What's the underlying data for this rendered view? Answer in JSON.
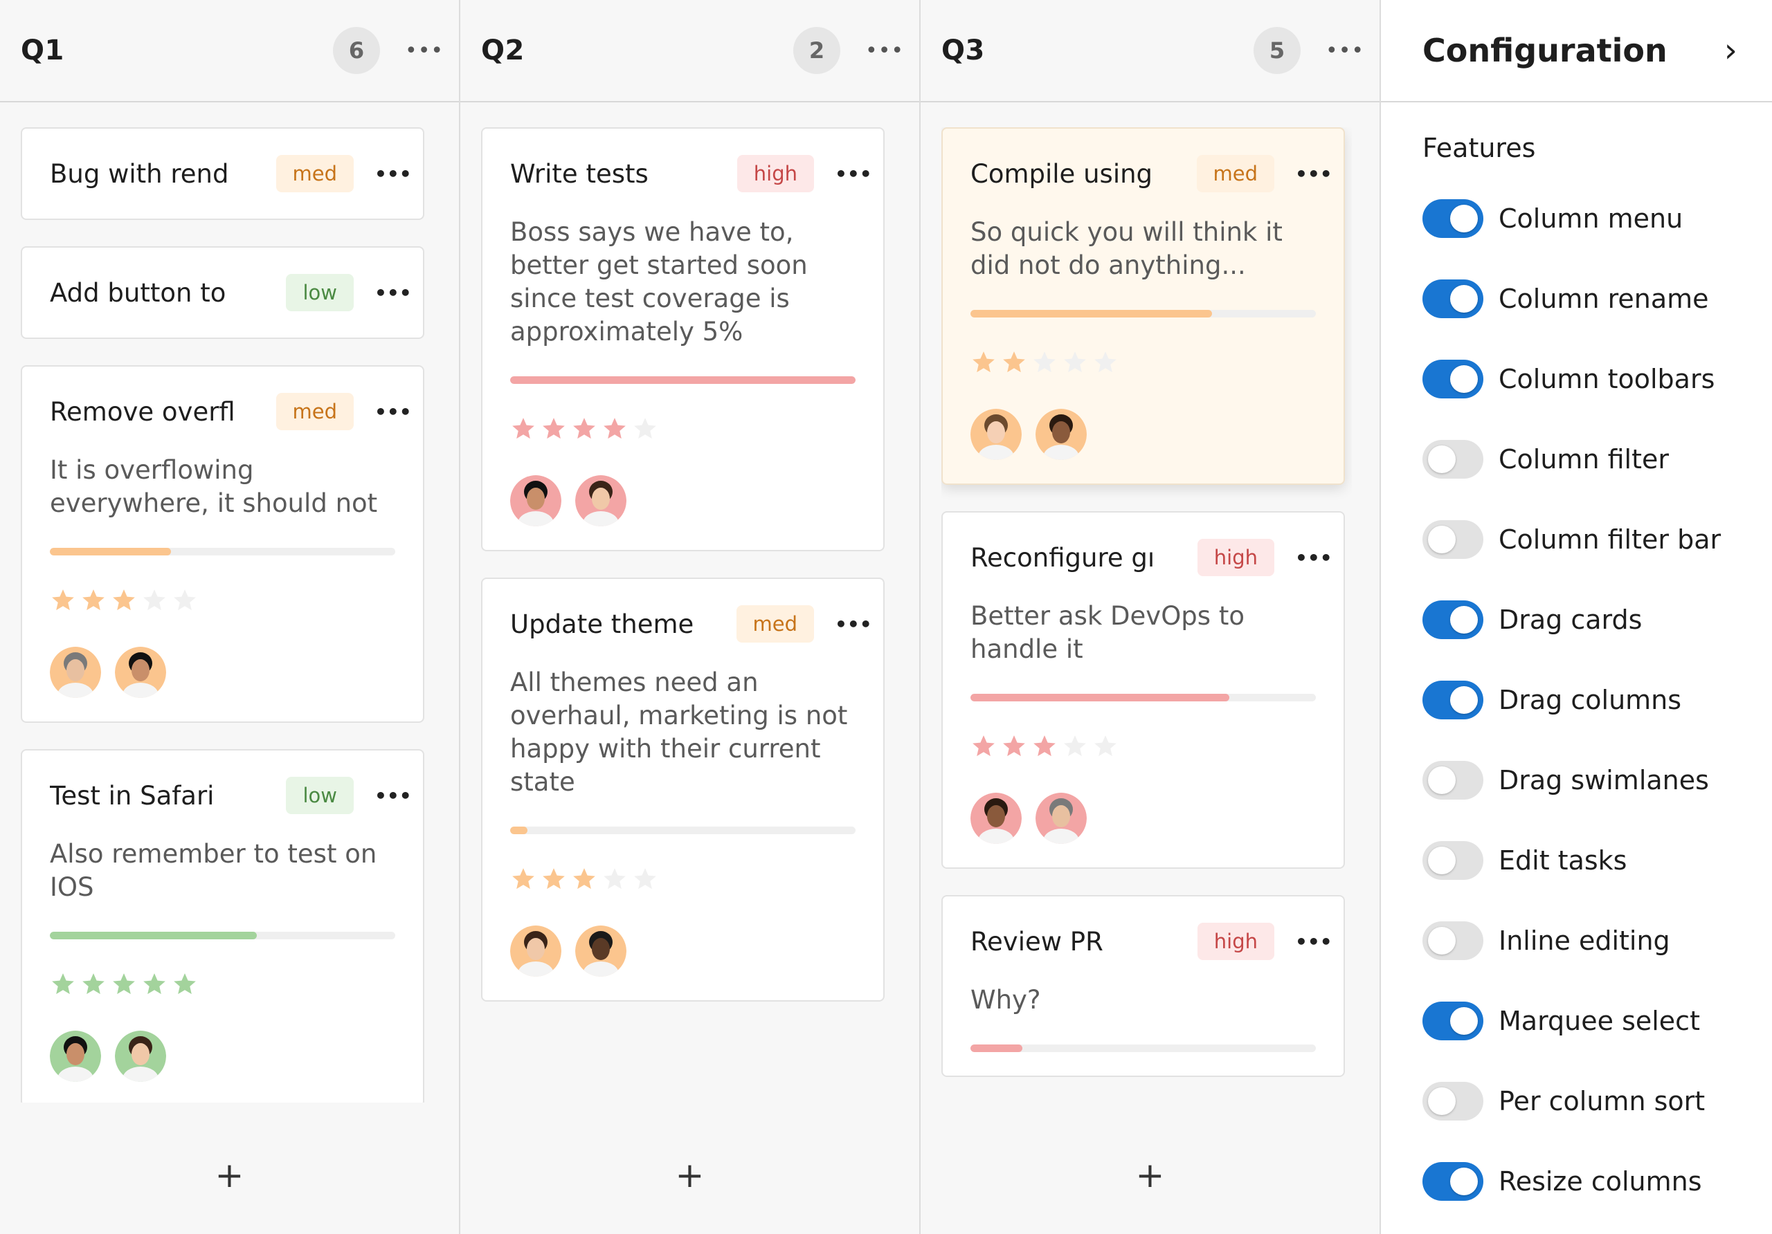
{
  "columns": [
    {
      "title": "Q1",
      "count": "6",
      "add_label": "+",
      "cards": [
        {
          "title": "Bug with rend",
          "priority": "med",
          "desc": "",
          "progress": 0,
          "stars": 0,
          "avatars": []
        },
        {
          "title": "Add button to",
          "priority": "low",
          "desc": "",
          "progress": 0,
          "stars": 0,
          "avatars": []
        },
        {
          "title": "Remove overfl",
          "priority": "med",
          "desc": "It is overflowing everywhere, it should not",
          "progress": 0.35,
          "stars": 3,
          "avatars": [
            "woman-curly",
            "man-beard"
          ]
        },
        {
          "title": "Test in Safari",
          "priority": "low",
          "desc": "Also remember to test on IOS",
          "progress": 0.6,
          "stars": 5,
          "avatars": [
            "man-beard-2",
            "woman-glasses"
          ]
        }
      ]
    },
    {
      "title": "Q2",
      "count": "2",
      "add_label": "+",
      "cards": [
        {
          "title": "Write tests",
          "priority": "high",
          "desc": "Boss says we have to, better get started soon since test coverage is approximately 5%",
          "progress": 1.0,
          "stars": 4,
          "avatars": [
            "woman-asian",
            "woman-dark-hair"
          ]
        },
        {
          "title": "Update theme",
          "priority": "med",
          "desc": "All themes need an overhaul, marketing is not happy with their current state",
          "progress": 0.05,
          "stars": 3,
          "avatars": [
            "man-gray",
            "woman-black"
          ]
        }
      ]
    },
    {
      "title": "Q3",
      "count": "5",
      "add_label": "+",
      "cards": [
        {
          "title": "Compile using",
          "priority": "med",
          "desc": "So quick you will think it did not do anything...",
          "progress": 0.7,
          "stars": 2,
          "avatars": [
            "man-dark",
            "woman-light"
          ],
          "highlight": true
        },
        {
          "title": "Reconfigure gı",
          "priority": "high",
          "desc": "Better ask DevOps to handle it",
          "progress": 0.75,
          "stars": 3,
          "avatars": [
            "woman-light-2",
            "man-glasses"
          ]
        },
        {
          "title": "Review PR",
          "priority": "high",
          "desc": "Why?",
          "progress": 0.15,
          "stars": 0,
          "avatars": []
        }
      ]
    }
  ],
  "config": {
    "title": "Configuration",
    "chevron": "›",
    "features_label": "Features",
    "features": [
      {
        "label": "Column menu",
        "on": true
      },
      {
        "label": "Column rename",
        "on": true
      },
      {
        "label": "Column toolbars",
        "on": true
      },
      {
        "label": "Column filter",
        "on": false
      },
      {
        "label": "Column filter bar",
        "on": false
      },
      {
        "label": "Drag cards",
        "on": true
      },
      {
        "label": "Drag columns",
        "on": true
      },
      {
        "label": "Drag swimlanes",
        "on": false
      },
      {
        "label": "Edit tasks",
        "on": false
      },
      {
        "label": "Inline editing",
        "on": false
      },
      {
        "label": "Marquee select",
        "on": true
      },
      {
        "label": "Per column sort",
        "on": false
      },
      {
        "label": "Resize columns",
        "on": true
      }
    ]
  },
  "colors": {
    "med": "#fbc58e",
    "low": "#a3d39c",
    "high": "#f3a5a5",
    "toggle_on": "#1976d2"
  }
}
